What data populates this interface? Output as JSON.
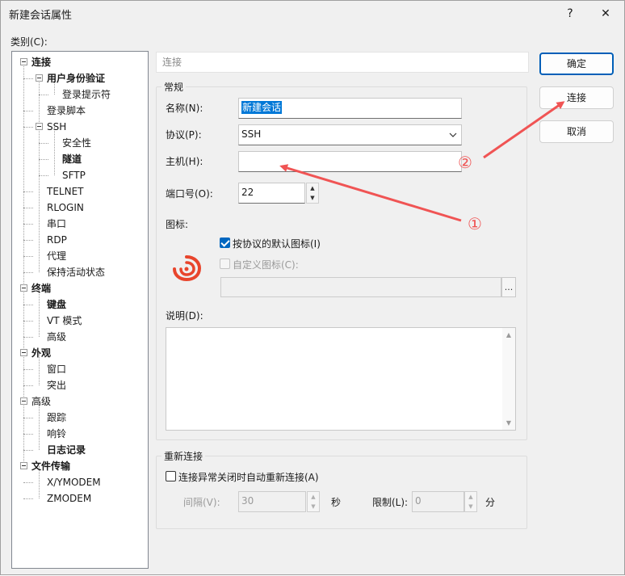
{
  "window": {
    "title": "新建会话属性",
    "help_glyph": "?",
    "close_glyph": "✕"
  },
  "category_label": "类别(C):",
  "tree": {
    "items": [
      {
        "label": "连接",
        "bold": true
      },
      {
        "label": "用户身份验证",
        "bold": true
      },
      {
        "label": "登录提示符",
        "bold": false
      },
      {
        "label": "登录脚本",
        "bold": false
      },
      {
        "label": "SSH",
        "bold": false
      },
      {
        "label": "安全性",
        "bold": false
      },
      {
        "label": "隧道",
        "bold": true
      },
      {
        "label": "SFTP",
        "bold": false
      },
      {
        "label": "TELNET",
        "bold": false
      },
      {
        "label": "RLOGIN",
        "bold": false
      },
      {
        "label": "串口",
        "bold": false
      },
      {
        "label": "RDP",
        "bold": false
      },
      {
        "label": "代理",
        "bold": false
      },
      {
        "label": "保持活动状态",
        "bold": false
      },
      {
        "label": "终端",
        "bold": true
      },
      {
        "label": "键盘",
        "bold": true
      },
      {
        "label": "VT 模式",
        "bold": false
      },
      {
        "label": "高级",
        "bold": false
      },
      {
        "label": "外观",
        "bold": true
      },
      {
        "label": "窗口",
        "bold": false
      },
      {
        "label": "突出",
        "bold": false
      },
      {
        "label": "高级",
        "bold": false
      },
      {
        "label": "跟踪",
        "bold": false
      },
      {
        "label": "响铃",
        "bold": false
      },
      {
        "label": "日志记录",
        "bold": true
      },
      {
        "label": "文件传输",
        "bold": true
      },
      {
        "label": "X/YMODEM",
        "bold": false
      },
      {
        "label": "ZMODEM",
        "bold": false
      }
    ]
  },
  "header_field": {
    "text": "连接"
  },
  "general": {
    "group_title": "常规",
    "name_label": "名称(N):",
    "name_value": "新建会话",
    "protocol_label": "协议(P):",
    "protocol_value": "SSH",
    "host_label": "主机(H):",
    "host_value": "",
    "port_label": "端口号(O):",
    "port_value": "22",
    "icon_label": "图标:",
    "default_icon_label": "按协议的默认图标(I)",
    "default_icon_checked": true,
    "custom_icon_label": "自定义图标(C):",
    "custom_icon_checked": false,
    "custom_icon_path": "",
    "browse_label": "...",
    "description_label": "说明(D):",
    "description_value": ""
  },
  "reconnect": {
    "group_title": "重新连接",
    "auto_label": "连接异常关闭时自动重新连接(A)",
    "auto_checked": false,
    "interval_label": "间隔(V):",
    "interval_value": "30",
    "interval_unit": "秒",
    "limit_label": "限制(L):",
    "limit_value": "0",
    "limit_unit": "分"
  },
  "buttons": {
    "ok": "确定",
    "connect": "连接",
    "cancel": "取消"
  },
  "annotations": {
    "marker_1": "①",
    "marker_2": "②",
    "color": "#f05454"
  },
  "colors": {
    "accent": "#0067c0",
    "selection": "#0078d7",
    "app_icon": "#e8452c"
  }
}
